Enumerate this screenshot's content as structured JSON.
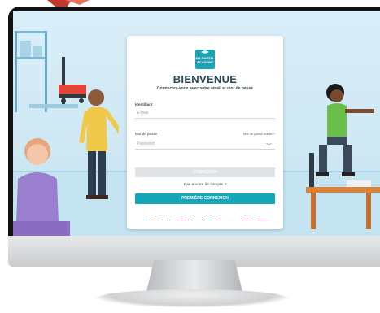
{
  "login": {
    "title": "BIENVENUE",
    "subtitle": "Connectez-vous avec votre email et mot de passe",
    "logo_text": "MY DIGITAL ACADEMY",
    "identifier_label": "Identifiant",
    "email_placeholder": "E-mail",
    "password_label": "Mot de passe",
    "forgot_link": "Mot de passe oublié ?",
    "password_placeholder": "Password",
    "login_button": "CONNEXION",
    "no_account": "Pas encore de compte ?",
    "first_login_button": "PREMIÈRE CONNEXION"
  },
  "languages": [
    {
      "name": "fr-flag-icon"
    },
    {
      "name": "uk-flag-icon"
    },
    {
      "name": "es-flag-icon"
    },
    {
      "name": "de-flag-icon"
    },
    {
      "name": "it-flag-icon"
    },
    {
      "name": "pl-flag-icon"
    },
    {
      "name": "nl-flag-icon"
    },
    {
      "name": "hu-flag-icon"
    }
  ],
  "colors": {
    "accent": "#17a6b8",
    "title": "#2b4a57",
    "disabled_button": "#dfe3e6"
  }
}
